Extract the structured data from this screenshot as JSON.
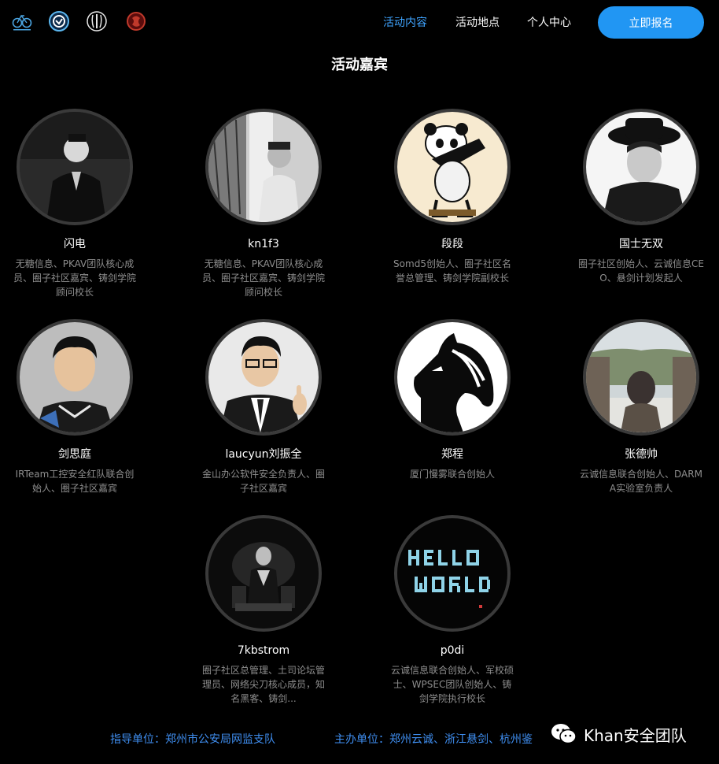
{
  "header": {
    "logos": [
      "bike-logo-icon",
      "shield-logo-icon",
      "laurel-logo-icon",
      "red-emblem-icon"
    ],
    "nav": [
      "活动内容",
      "活动地点",
      "个人中心"
    ],
    "cta": "立即报名",
    "active_color": "#3fa4ff",
    "cta_color": "#2196f3"
  },
  "section": {
    "title": "活动嘉宾"
  },
  "guests": [
    {
      "name": "闪电",
      "desc": "无糖信息、PKAV团队核心成员、圈子社区嘉宾、铸剑学院顾问校长"
    },
    {
      "name": "kn1f3",
      "desc": "无糖信息、PKAV团队核心成员、圈子社区嘉宾、铸剑学院顾问校长"
    },
    {
      "name": "段段",
      "desc": "Somd5创始人、圈子社区名誉总管理、铸剑学院副校长"
    },
    {
      "name": "国士无双",
      "desc": "圈子社区创始人、云诚信息CEO、悬剑计划发起人"
    },
    {
      "name": "剑思庭",
      "desc": "IRTeam工控安全红队联合创始人、圈子社区嘉宾"
    },
    {
      "name": "laucyun刘振全",
      "desc": "金山办公软件安全负责人、圈子社区嘉宾"
    },
    {
      "name": "郑程",
      "desc": "厦门慢雾联合创始人"
    },
    {
      "name": "张德帅",
      "desc": "云诚信息联合创始人、DARMA实验室负责人"
    },
    {
      "name": "7kbstrom",
      "desc": "圈子社区总管理、土司论坛管理员、网络尖刀核心成员，知名黑客、铸剑..."
    },
    {
      "name": "p0di",
      "desc": "云诚信息联合创始人、军校硕士、WPSEC团队创始人、铸剑学院执行校长"
    }
  ],
  "footer": {
    "guide": "指导单位：郑州市公安局网监支队",
    "host": "主办单位：郑州云诚、浙江悬剑、杭州鉴",
    "watermark": "Khan安全团队",
    "link_color": "#3f8ef0"
  }
}
